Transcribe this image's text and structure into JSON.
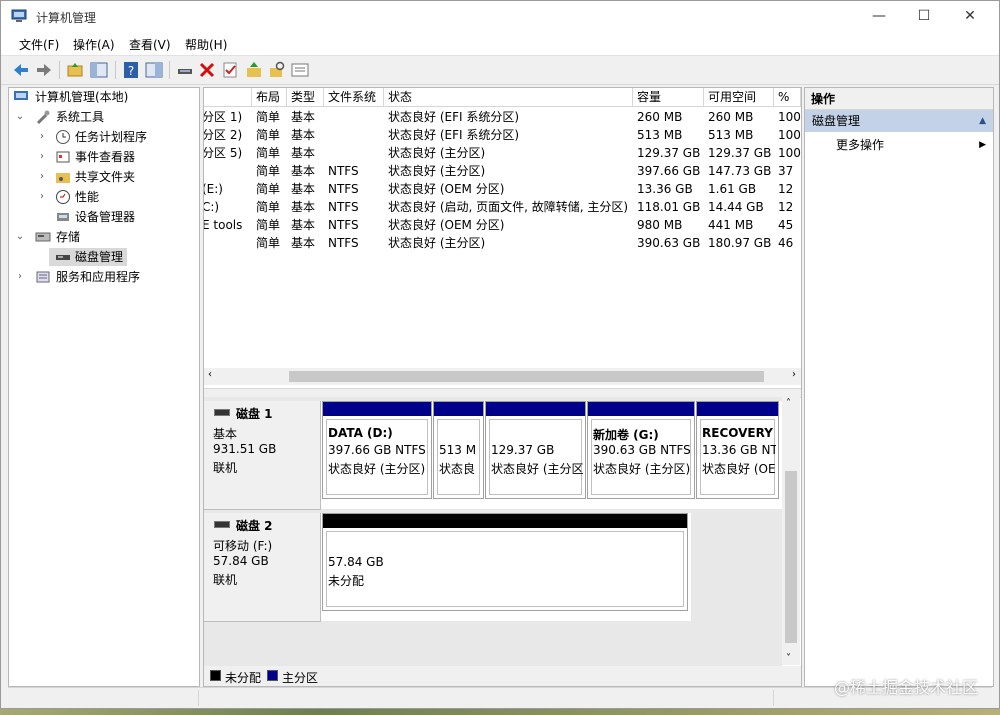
{
  "window": {
    "title": "计算机管理",
    "min": "—",
    "max": "☐",
    "close": "✕"
  },
  "menu": [
    "文件(F)",
    "操作(A)",
    "查看(V)",
    "帮助(H)"
  ],
  "toolbar_icons": [
    "back-arrow-icon",
    "forward-arrow-icon",
    "up-folder-icon",
    "show-tree-icon",
    "help-icon",
    "console-icon",
    "connect-icon",
    "delete-icon",
    "properties-icon",
    "import-icon",
    "search-icon",
    "list-icon"
  ],
  "tree": {
    "root": "计算机管理(本地)",
    "system_tools": "系统工具",
    "task_scheduler": "任务计划程序",
    "event_viewer": "事件查看器",
    "shared_folders": "共享文件夹",
    "performance": "性能",
    "device_manager": "设备管理器",
    "storage": "存储",
    "disk_management": "磁盘管理",
    "services_apps": "服务和应用程序"
  },
  "columns": {
    "layout": "布局",
    "type": "类型",
    "fs": "文件系统",
    "status": "状态",
    "capacity": "容量",
    "free": "可用空间",
    "pct": "%"
  },
  "volumes": [
    {
      "name": "分区 1)",
      "layout": "简单",
      "type": "基本",
      "fs": "",
      "status": "状态良好 (EFI 系统分区)",
      "capacity": "260 MB",
      "free": "260 MB",
      "pct": "100"
    },
    {
      "name": "分区 2)",
      "layout": "简单",
      "type": "基本",
      "fs": "",
      "status": "状态良好 (EFI 系统分区)",
      "capacity": "513 MB",
      "free": "513 MB",
      "pct": "100"
    },
    {
      "name": "分区 5)",
      "layout": "简单",
      "type": "基本",
      "fs": "",
      "status": "状态良好 (主分区)",
      "capacity": "129.37 GB",
      "free": "129.37 GB",
      "pct": "100"
    },
    {
      "name": "",
      "layout": "简单",
      "type": "基本",
      "fs": "NTFS",
      "status": "状态良好 (主分区)",
      "capacity": "397.66 GB",
      "free": "147.73 GB",
      "pct": "37"
    },
    {
      "name": "(E:)",
      "layout": "简单",
      "type": "基本",
      "fs": "NTFS",
      "status": "状态良好 (OEM 分区)",
      "capacity": "13.36 GB",
      "free": "1.61 GB",
      "pct": "12"
    },
    {
      "name": "C:)",
      "layout": "简单",
      "type": "基本",
      "fs": "NTFS",
      "status": "状态良好 (启动, 页面文件, 故障转储, 主分区)",
      "capacity": "118.01 GB",
      "free": "14.44 GB",
      "pct": "12"
    },
    {
      "name": "E tools",
      "layout": "简单",
      "type": "基本",
      "fs": "NTFS",
      "status": "状态良好 (OEM 分区)",
      "capacity": "980 MB",
      "free": "441 MB",
      "pct": "45"
    },
    {
      "name": "",
      "layout": "简单",
      "type": "基本",
      "fs": "NTFS",
      "status": "状态良好 (主分区)",
      "capacity": "390.63 GB",
      "free": "180.97 GB",
      "pct": "46"
    }
  ],
  "disk1": {
    "name": "磁盘 1",
    "kind": "基本",
    "size": "931.51 GB",
    "state": "联机",
    "parts": [
      {
        "title": "DATA  (D:)",
        "size": "397.66 GB NTFS",
        "status": "状态良好 (主分区)"
      },
      {
        "title": "",
        "size": "513 M",
        "status": "状态良"
      },
      {
        "title": "",
        "size": "129.37 GB",
        "status": "状态良好 (主分区)"
      },
      {
        "title": "新加卷  (G:)",
        "size": "390.63 GB NTFS",
        "status": "状态良好 (主分区)"
      },
      {
        "title": "RECOVERY",
        "size": "13.36 GB NTFS",
        "status": "状态良好 (OEM 分区)"
      }
    ]
  },
  "disk2": {
    "name": "磁盘 2",
    "kind": "可移动 (F:)",
    "size": "57.84 GB",
    "state": "联机",
    "parts": [
      {
        "size": "57.84 GB",
        "status": "未分配"
      }
    ]
  },
  "legend": {
    "unallocated": "未分配",
    "primary": "主分区"
  },
  "colors": {
    "primary": "#00008b",
    "unallocated": "#000000",
    "selected": "#c4d2e8"
  },
  "actions": {
    "header": "操作",
    "section": "磁盘管理",
    "more": "更多操作"
  },
  "watermark": "@稀土掘金技术社区"
}
